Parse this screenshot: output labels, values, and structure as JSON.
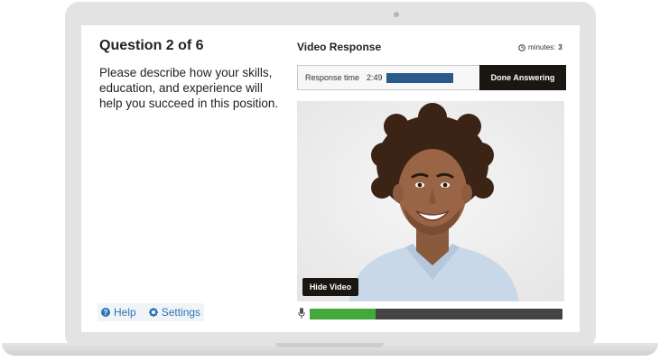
{
  "question": {
    "title": "Question 2 of 6",
    "text": "Please describe how your skills, education, and experience will help you succeed in this position."
  },
  "footer": {
    "help_label": "Help",
    "settings_label": "Settings",
    "help_icon": "question-circle-icon",
    "settings_icon": "gear-icon"
  },
  "video_response": {
    "title": "Video Response",
    "minutes_label": "minutes:",
    "minutes_value": "3",
    "response_time_label": "Response time",
    "response_time_value": "2:49",
    "response_progress": 1.0,
    "done_label": "Done Answering",
    "hide_video_label": "Hide Video",
    "audio_level": 0.26
  },
  "colors": {
    "accent_link": "#2c73b8",
    "progress_blue": "#2a5a8c",
    "button_dark": "#1a1612",
    "audio_green": "#45a83a"
  }
}
